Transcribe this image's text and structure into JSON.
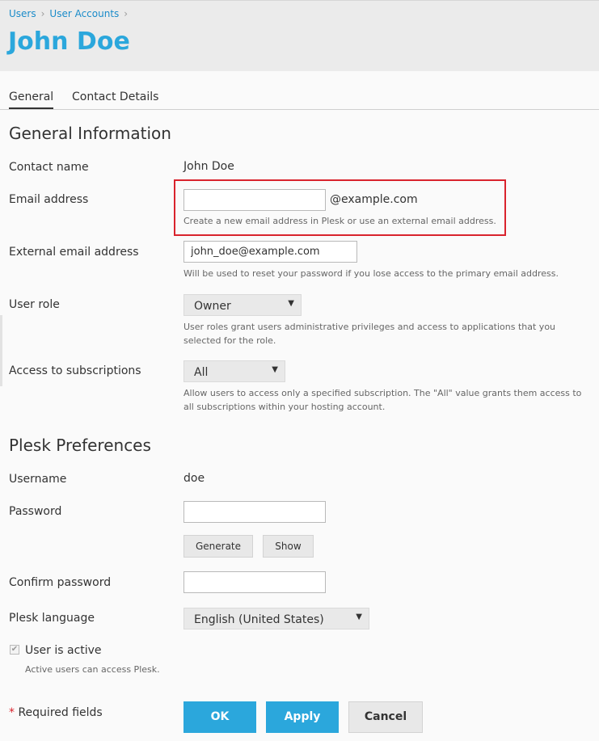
{
  "breadcrumb": {
    "items": [
      "Users",
      "User Accounts"
    ]
  },
  "page": {
    "title": "John Doe"
  },
  "tabs": [
    {
      "label": "General",
      "active": true
    },
    {
      "label": "Contact Details",
      "active": false
    }
  ],
  "general": {
    "title": "General Information",
    "contact_name_label": "Contact name",
    "contact_name_value": "John Doe",
    "email_label": "Email address",
    "email_value": "",
    "email_domain": "@example.com",
    "email_hint": "Create a new email address in Plesk or use an external email address.",
    "external_email_label": "External email address",
    "external_email_value": "john_doe@example.com",
    "external_email_hint": "Will be used to reset your password if you lose access to the primary email address.",
    "user_role_label": "User role",
    "user_role_value": "Owner",
    "user_role_hint_1": "User roles grant users administrative privileges and access to applications that you",
    "user_role_hint_2": "selected for the role.",
    "access_label": "Access to subscriptions",
    "access_value": "All",
    "access_hint_1": "Allow users to access only a specified subscription. The \"All\" value grants them access to",
    "access_hint_2": "all subscriptions within your hosting account."
  },
  "preferences": {
    "title": "Plesk Preferences",
    "username_label": "Username",
    "username_value": "doe",
    "password_label": "Password",
    "password_value": "",
    "generate_label": "Generate",
    "show_label": "Show",
    "confirm_label": "Confirm password",
    "confirm_value": "",
    "language_label": "Plesk language",
    "language_value": "English (United States)",
    "active_label": "User is active",
    "active_checked": true,
    "active_hint": "Active users can access Plesk."
  },
  "footer": {
    "required_star": "*",
    "required_label": "Required fields",
    "ok_label": "OK",
    "apply_label": "Apply",
    "cancel_label": "Cancel"
  },
  "colors": {
    "accent": "#2ba7dc",
    "link": "#1a8bc9",
    "highlight": "#d9232d",
    "header_bg": "#ebebeb"
  }
}
